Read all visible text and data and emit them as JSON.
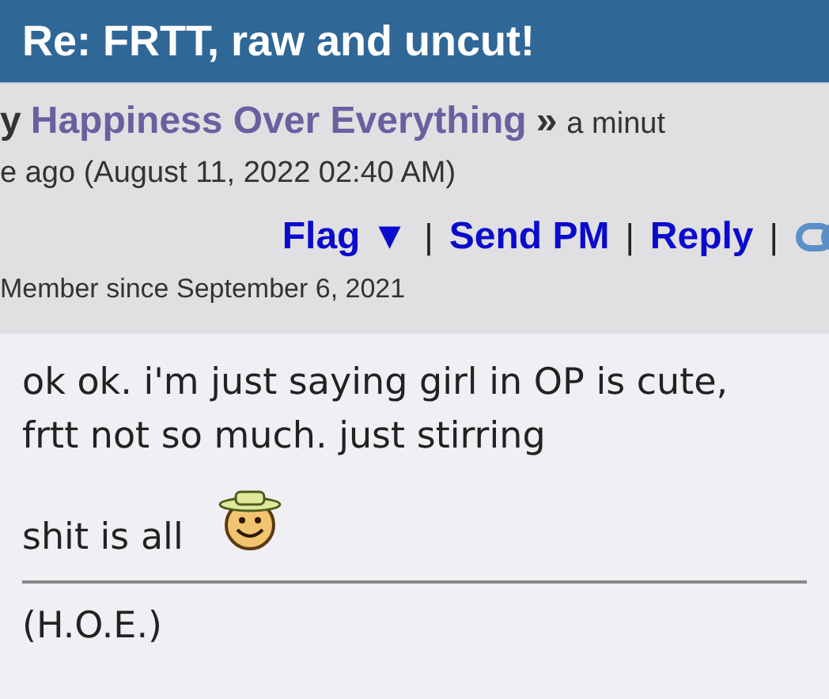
{
  "title": "Re: FRTT, raw and uncut!",
  "post": {
    "byline_prefix": "y",
    "author": "Happiness Over Everything",
    "separator": "»",
    "time_text": "a minut",
    "time_text_cont": "e ago (August 11, 2022 02:40 AM)",
    "actions": [
      {
        "label": "Flag ▼",
        "separator": "|"
      },
      {
        "label": "Send PM",
        "separator": "|"
      },
      {
        "label": "Reply",
        "separator": "|"
      }
    ],
    "member_since": "Member since September 6, 2021",
    "body": "ok ok. i'm just saying girl in OP is cute, frtt not so much. just stirring",
    "body_end": "shit is all",
    "signature": "(H.O.E.)"
  }
}
